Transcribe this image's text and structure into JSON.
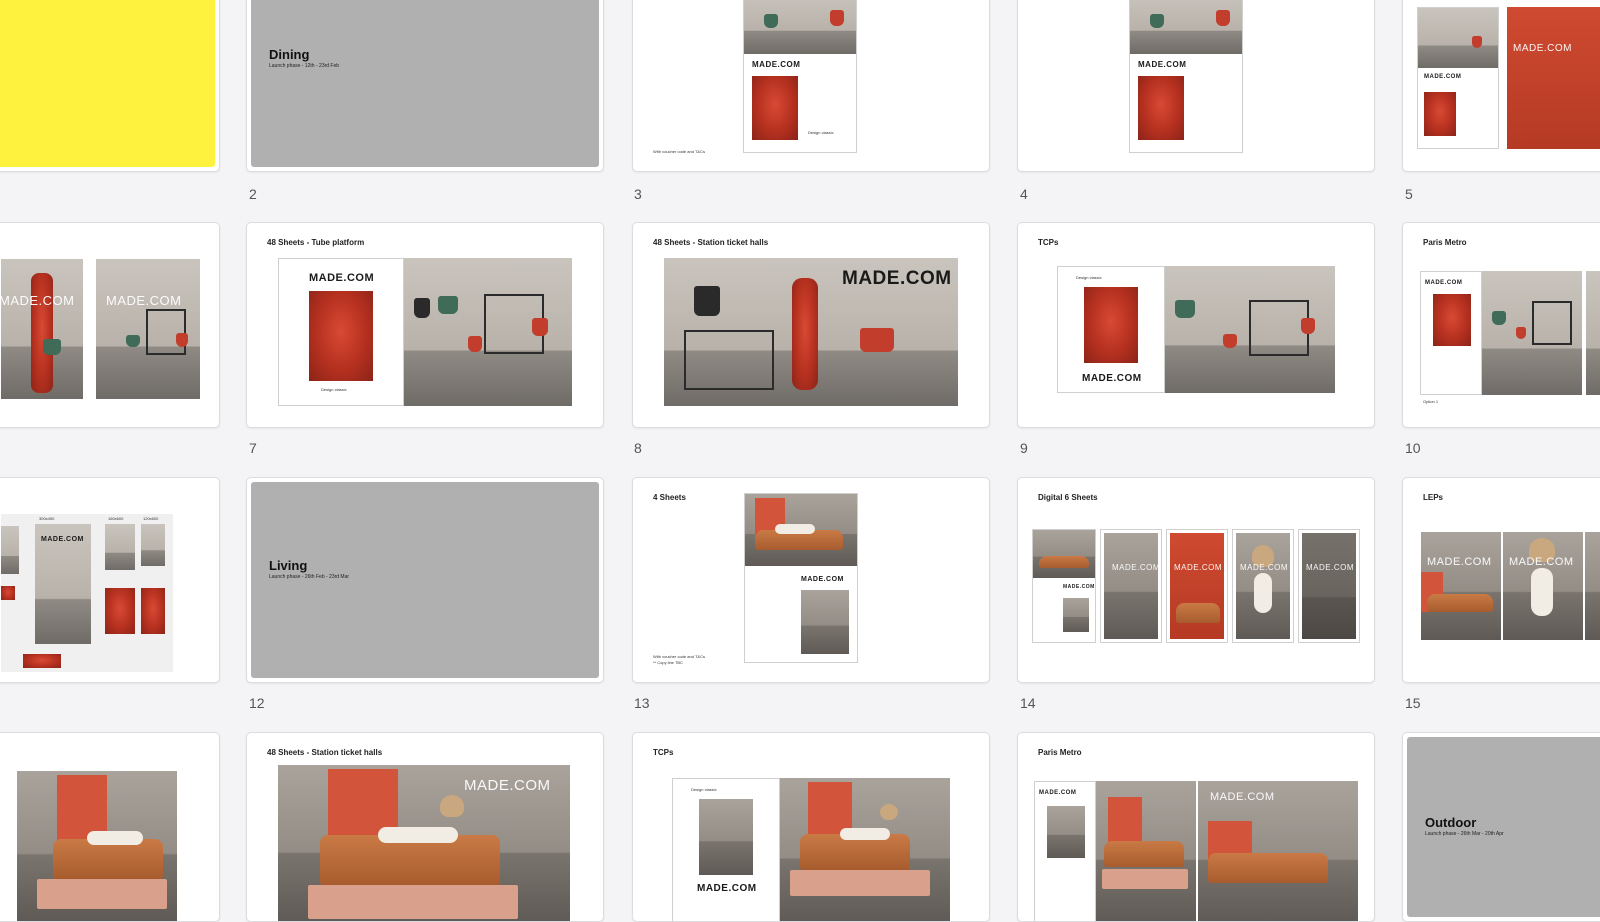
{
  "slides": {
    "s2": {
      "number": "2",
      "title": "Dining",
      "subtitle": "Launch phase - 12th - 23rd Feb"
    },
    "s3": {
      "number": "3",
      "logo": "MADE.COM",
      "footer": "With voucher code and T&Cs"
    },
    "s4": {
      "number": "4",
      "logo": "MADE.COM"
    },
    "s5": {
      "number": "5",
      "logo": "MADE.COM"
    },
    "s6": {
      "logo": "MADE.COM"
    },
    "s7": {
      "number": "7",
      "title": "48 Sheets - Tube platform",
      "logo": "MADE.COM"
    },
    "s8": {
      "number": "8",
      "title": "48 Sheets - Station ticket halls",
      "logo": "MADE.COM"
    },
    "s9": {
      "number": "9",
      "title": "TCPs",
      "logo": "MADE.COM"
    },
    "s10": {
      "number": "10",
      "title": "Paris Metro",
      "logo": "MADE.COM",
      "option": "Option 1"
    },
    "s11": {
      "sizes": [
        "300x400",
        "160x600",
        "120x600"
      ],
      "logo": "MADE.COM"
    },
    "s12": {
      "number": "12",
      "title": "Living",
      "subtitle": "Launch phase - 26th Feb - 23rd Mar"
    },
    "s13": {
      "number": "13",
      "title": "4 Sheets",
      "logo": "MADE.COM",
      "footer": "With voucher code and T&Cs",
      "footer2": "** Copy line TBC"
    },
    "s14": {
      "number": "14",
      "title": "Digital 6 Sheets",
      "logo": "MADE.COM"
    },
    "s15": {
      "number": "15",
      "title": "LEPs",
      "logo": "MADE.COM"
    },
    "s17": {
      "title": "48 Sheets - Station ticket halls",
      "logo": "MADE.COM"
    },
    "s18": {
      "title": "TCPs",
      "logo": "MADE.COM"
    },
    "s19": {
      "title": "Paris Metro",
      "logo": "MADE.COM"
    },
    "s20": {
      "title": "Outdoor",
      "subtitle": "Launch phase - 26th Mar - 20th Apr"
    }
  }
}
